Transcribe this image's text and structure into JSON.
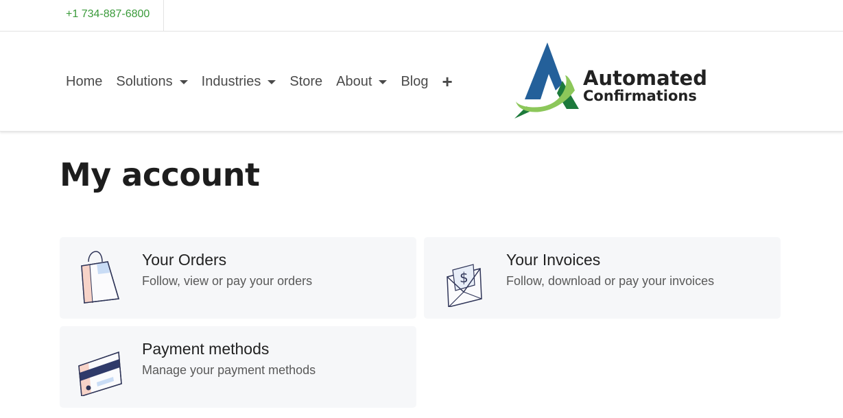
{
  "topbar": {
    "phone": "+1 734-887-6800"
  },
  "nav": {
    "items": [
      {
        "label": "Home",
        "dropdown": false
      },
      {
        "label": "Solutions",
        "dropdown": true
      },
      {
        "label": "Industries",
        "dropdown": true
      },
      {
        "label": "Store",
        "dropdown": false
      },
      {
        "label": "About",
        "dropdown": true
      },
      {
        "label": "Blog",
        "dropdown": false
      }
    ],
    "more_icon": "plus-icon"
  },
  "logo": {
    "line1": "Automated",
    "line2": "Confirmations",
    "colors": {
      "blue": "#24609a",
      "green": "#8cc75a",
      "dark_green": "#1d7a3c"
    }
  },
  "page": {
    "title": "My account"
  },
  "cards": [
    {
      "title": "Your Orders",
      "description": "Follow, view or pay your orders",
      "icon": "shopping-bag-icon"
    },
    {
      "title": "Your Invoices",
      "description": "Follow, download or pay your invoices",
      "icon": "invoice-envelope-icon"
    },
    {
      "title": "Payment methods",
      "description": "Manage your payment methods",
      "icon": "credit-card-icon"
    }
  ]
}
